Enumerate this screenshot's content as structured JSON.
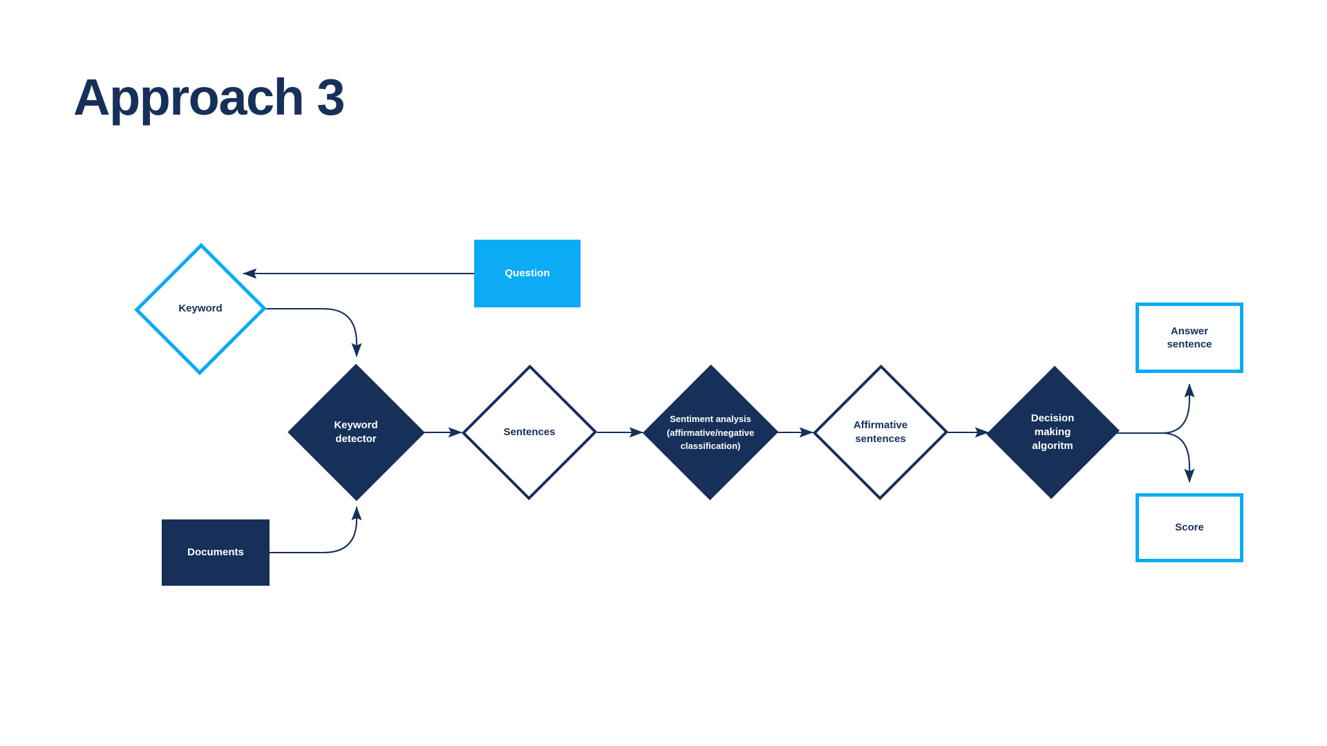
{
  "page": {
    "title": "Approach 3",
    "background": "#FFFFFF"
  },
  "colors": {
    "navy": "#16305A",
    "light_blue": "#0BABF5",
    "white": "#FFFFFF",
    "arrow": "#16305A"
  },
  "diagram": {
    "type": "flowchart",
    "nodes": [
      {
        "id": "keyword",
        "label": "Keyword",
        "shape": "diamond",
        "style": "outline",
        "stroke": "#0BABF5",
        "fill": "#FFFFFF",
        "text_color": "#16305A",
        "font_size": 15
      },
      {
        "id": "question",
        "label": "Question",
        "shape": "rectangle",
        "style": "filled",
        "stroke": "#0BABF5",
        "fill": "#0BABF5",
        "text_color": "#FFFFFF",
        "font_size": 15
      },
      {
        "id": "keyword-detector",
        "label": "Keyword\ndetector",
        "shape": "diamond",
        "style": "filled",
        "stroke": "#16305A",
        "fill": "#16305A",
        "text_color": "#FFFFFF",
        "font_size": 15
      },
      {
        "id": "documents",
        "label": "Documents",
        "shape": "rectangle",
        "style": "filled",
        "stroke": "#16305A",
        "fill": "#16305A",
        "text_color": "#FFFFFF",
        "font_size": 15
      },
      {
        "id": "sentences",
        "label": "Sentences",
        "shape": "diamond",
        "style": "outline",
        "stroke": "#16305A",
        "fill": "#FFFFFF",
        "text_color": "#16305A",
        "font_size": 15
      },
      {
        "id": "sentiment-analysis",
        "label": "Sentiment analysis\n(affirmative/negative\nclassification)",
        "shape": "diamond",
        "style": "filled",
        "stroke": "#16305A",
        "fill": "#16305A",
        "text_color": "#FFFFFF",
        "font_size": 13
      },
      {
        "id": "affirmative-sentences",
        "label": "Affirmative\nsentences",
        "shape": "diamond",
        "style": "outline",
        "stroke": "#16305A",
        "fill": "#FFFFFF",
        "text_color": "#16305A",
        "font_size": 15
      },
      {
        "id": "decision-making-algoritm",
        "label": "Decision\nmaking\nalgoritm",
        "shape": "diamond",
        "style": "filled",
        "stroke": "#16305A",
        "fill": "#16305A",
        "text_color": "#FFFFFF",
        "font_size": 15
      },
      {
        "id": "answer-sentence",
        "label": "Answer\nsentence",
        "shape": "rectangle",
        "style": "outline",
        "stroke": "#0BABF5",
        "fill": "#FFFFFF",
        "text_color": "#16305A",
        "font_size": 15
      },
      {
        "id": "score",
        "label": "Score",
        "shape": "rectangle",
        "style": "outline",
        "stroke": "#0BABF5",
        "fill": "#FFFFFF",
        "text_color": "#16305A",
        "font_size": 15
      }
    ],
    "edges": [
      {
        "id": "question-to-keyword",
        "from": "question",
        "to": "keyword",
        "style": "straight",
        "direction": "right-to-left"
      },
      {
        "id": "keyword-to-keyword-detector",
        "from": "keyword",
        "to": "keyword-detector",
        "style": "curved"
      },
      {
        "id": "documents-to-keyword-detector",
        "from": "documents",
        "to": "keyword-detector",
        "style": "curved"
      },
      {
        "id": "keyword-detector-to-sentences",
        "from": "keyword-detector",
        "to": "sentences",
        "style": "straight"
      },
      {
        "id": "sentences-to-sentiment-analysis",
        "from": "sentences",
        "to": "sentiment-analysis",
        "style": "straight"
      },
      {
        "id": "sentiment-analysis-to-affirmative-sentences",
        "from": "sentiment-analysis",
        "to": "affirmative-sentences",
        "style": "straight"
      },
      {
        "id": "affirmative-sentences-to-decision-making",
        "from": "affirmative-sentences",
        "to": "decision-making-algoritm",
        "style": "straight"
      },
      {
        "id": "decision-making-to-answer-sentence",
        "from": "decision-making-algoritm",
        "to": "answer-sentence",
        "style": "curved"
      },
      {
        "id": "decision-making-to-score",
        "from": "decision-making-algoritm",
        "to": "score",
        "style": "curved"
      }
    ]
  }
}
